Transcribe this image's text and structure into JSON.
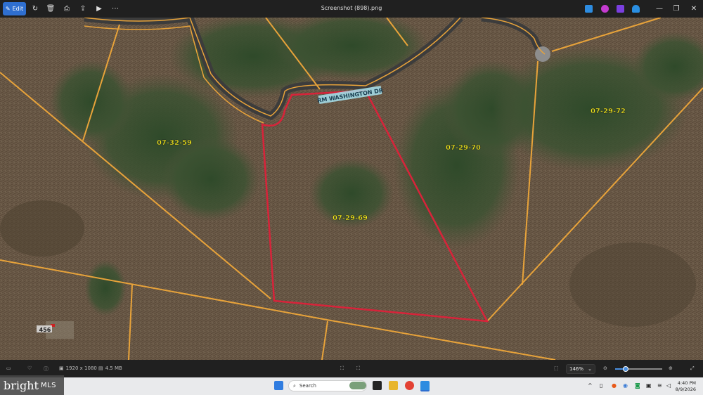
{
  "app": {
    "title": "Screenshot (898).png",
    "edit_label": "Edit"
  },
  "map": {
    "road_label": "RM WASHINGTON DR",
    "parcels": [
      {
        "id": "07-32-59"
      },
      {
        "id": "07-29-70"
      },
      {
        "id": "07-29-72"
      },
      {
        "id": "07-29-69"
      },
      {
        "id": "456"
      }
    ],
    "colors": {
      "subject_boundary": "#d8233a",
      "parcel_lines": "#e8a33a",
      "parcel_label": "#f2ea1c",
      "road_label_bg": "#a7e3f0"
    }
  },
  "status": {
    "dimensions": "1920 x 1080",
    "file_size": "4.5 MB",
    "zoom": "146%",
    "zoom_fraction": 0.22
  },
  "watermark": {
    "brand": "bright",
    "suffix": "MLS"
  },
  "taskbar": {
    "search_placeholder": "Search",
    "time": "4:40 PM",
    "date": "8/9/2026"
  }
}
